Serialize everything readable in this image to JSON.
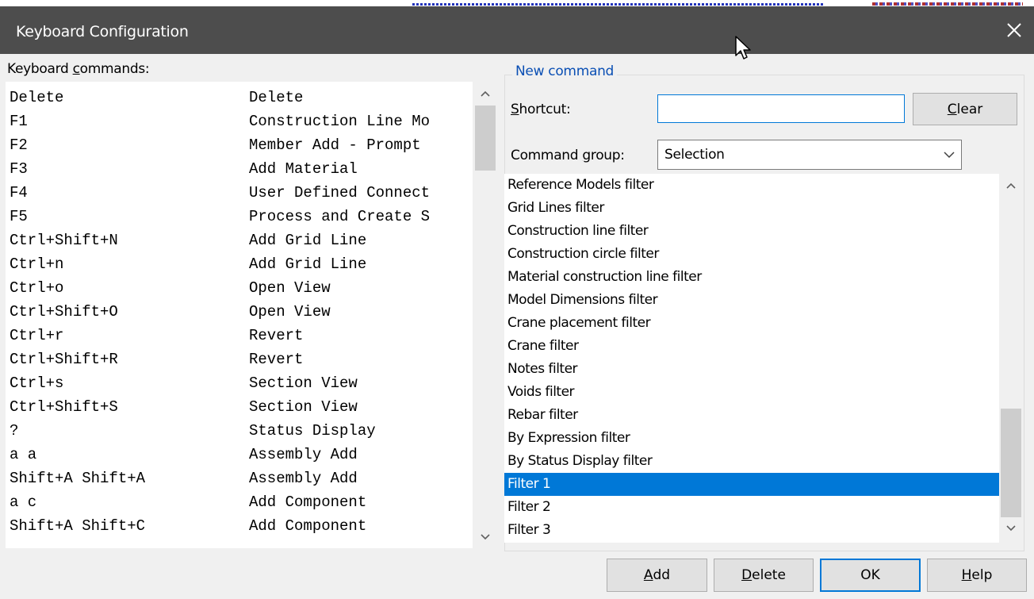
{
  "window": {
    "title": "Keyboard Configuration"
  },
  "left": {
    "label_pre": "Keyboard ",
    "label_mnemonic": "c",
    "label_post": "ommands:",
    "commands": [
      {
        "key": "Delete",
        "name": "Delete"
      },
      {
        "key": "F1",
        "name": "Construction Line Mo"
      },
      {
        "key": "F2",
        "name": "Member Add - Prompt"
      },
      {
        "key": "F3",
        "name": "Add Material"
      },
      {
        "key": "F4",
        "name": "User Defined Connect"
      },
      {
        "key": "F5",
        "name": "Process and Create S"
      },
      {
        "key": "Ctrl+Shift+N",
        "name": "Add Grid Line"
      },
      {
        "key": "Ctrl+n",
        "name": "Add Grid Line"
      },
      {
        "key": "Ctrl+o",
        "name": "Open View"
      },
      {
        "key": "Ctrl+Shift+O",
        "name": "Open View"
      },
      {
        "key": "Ctrl+r",
        "name": "Revert"
      },
      {
        "key": "Ctrl+Shift+R",
        "name": "Revert"
      },
      {
        "key": "Ctrl+s",
        "name": "Section View"
      },
      {
        "key": "Ctrl+Shift+S",
        "name": "Section View"
      },
      {
        "key": "?",
        "name": "Status Display"
      },
      {
        "key": "a a",
        "name": "Assembly Add"
      },
      {
        "key": "Shift+A Shift+A",
        "name": "Assembly Add"
      },
      {
        "key": "a c",
        "name": "Add Component"
      },
      {
        "key": "Shift+A Shift+C",
        "name": "Add Component"
      }
    ]
  },
  "new_command": {
    "legend": "New command",
    "shortcut_mnemonic": "S",
    "shortcut_rest": "hortcut:",
    "shortcut_value": "",
    "clear_mnemonic": "C",
    "clear_rest": "lear",
    "group_pre": "Command ",
    "group_mnemonic": "g",
    "group_post": "roup:",
    "group_value": "Selection",
    "filters": [
      "Reference Models filter",
      "Grid Lines filter",
      "Construction line filter",
      "Construction circle filter",
      "Material construction line filter",
      "Model Dimensions filter",
      "Crane placement filter",
      "Crane filter",
      "Notes filter",
      "Voids filter",
      "Rebar filter",
      "By Expression filter",
      "By Status Display filter",
      "Filter 1",
      "Filter 2",
      "Filter 3"
    ],
    "selected_filter": "Filter 1"
  },
  "buttons": {
    "add_mnemonic": "A",
    "add_rest": "dd",
    "delete_mnemonic": "D",
    "delete_rest": "elete",
    "ok_label": "OK",
    "help_mnemonic": "H",
    "help_rest": "elp"
  }
}
